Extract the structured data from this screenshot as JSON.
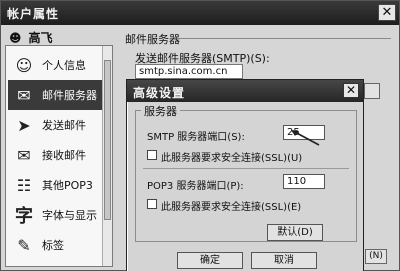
{
  "window": {
    "title": "帐户属性",
    "close_glyph": "✕"
  },
  "user": {
    "name": "高飞"
  },
  "sidebar": {
    "items": [
      {
        "label": "个人信息",
        "icon": "person-card-icon",
        "glyph": "👤"
      },
      {
        "label": "邮件服务器",
        "icon": "mail-server-icon",
        "glyph": "🖧",
        "selected": true
      },
      {
        "label": "发送邮件",
        "icon": "send-mail-icon",
        "glyph": "✉"
      },
      {
        "label": "接收邮件",
        "icon": "receive-mail-icon",
        "glyph": "✉"
      },
      {
        "label": "其他POP3",
        "icon": "pop3-icon",
        "glyph": "☷"
      },
      {
        "label": "字体与显示",
        "icon": "font-icon",
        "glyph": "字"
      },
      {
        "label": "标签",
        "icon": "tag-icon",
        "glyph": "✎"
      }
    ]
  },
  "mail_server": {
    "group_label": "邮件服务器",
    "smtp_label": "发送邮件服务器(SMTP)(S):",
    "smtp_value": "smtp.sina.com.cn"
  },
  "advanced_dialog": {
    "title": "高级设置",
    "close_glyph": "✕",
    "group_label": "服务器",
    "smtp_port_label": "SMTP 服务器端口(S):",
    "smtp_port_value": "25",
    "smtp_ssl_label": "此服务器要求安全连接(SSL)(U)",
    "smtp_ssl_checked": false,
    "pop3_port_label": "POP3 服务器端口(P):",
    "pop3_port_value": "110",
    "pop3_ssl_label": "此服务器要求安全连接(SSL)(E)",
    "pop3_ssl_checked": false,
    "default_button": "默认(D)",
    "ok_button": "确定",
    "cancel_button": "取消"
  },
  "footer": {
    "small_button": "(N)"
  }
}
